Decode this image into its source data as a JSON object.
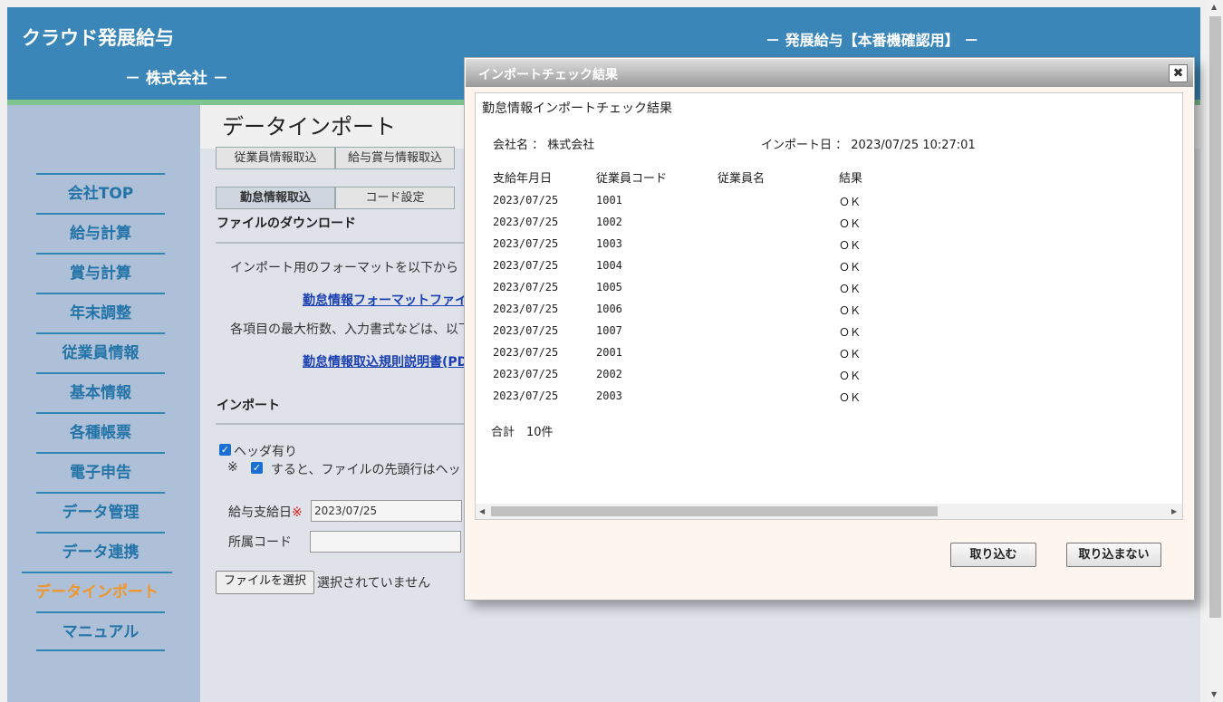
{
  "header": {
    "logo": "クラウド発展給与",
    "company": "－ 株式会社 －",
    "system_name": "－ 発展給与【本番機確認用】 －"
  },
  "sidebar": {
    "items": [
      {
        "label": "会社TOP"
      },
      {
        "label": "給与計算"
      },
      {
        "label": "賞与計算"
      },
      {
        "label": "年末調整"
      },
      {
        "label": "従業員情報"
      },
      {
        "label": "基本情報"
      },
      {
        "label": "各種帳票"
      },
      {
        "label": "電子申告"
      },
      {
        "label": "データ管理"
      },
      {
        "label": "データ連携"
      },
      {
        "label": "データインポート",
        "active": true
      },
      {
        "label": "マニュアル"
      }
    ]
  },
  "main": {
    "title": "データインポート",
    "tabs_row1": [
      "従業員情報取込",
      "給与賞与情報取込"
    ],
    "tabs_row2": [
      "勤怠情報取込",
      "コード設定"
    ],
    "download_section": "ファイルのダウンロード",
    "download_text": "インポート用のフォーマットを以下から",
    "format_link": "勤怠情報フォーマットファイ",
    "rules_text": "各項目の最大桁数、入力書式などは、以下",
    "rules_link": "勤怠情報取込規則説明書(PD",
    "import_section": "インポート",
    "header_checkbox_label": "ヘッダ有り",
    "note_prefix": "※",
    "note_text": "すると、ファイルの先頭行はヘッ",
    "payday_label": "給与支給日",
    "required_mark": "※",
    "payday_value": "2023/07/25",
    "dept_label": "所属コード",
    "dept_value": "",
    "file_button": "ファイルを選択",
    "file_status": "選択されていません"
  },
  "dialog": {
    "title": "インポートチェック結果",
    "close_symbol": "✖",
    "heading": "勤怠情報インポートチェック結果",
    "company_label": "会社名 ： 株式会社",
    "import_date_label": "インポート日 ： 2023/07/25 10:27:01",
    "columns": [
      "支給年月日",
      "従業員コード",
      "従業員名",
      "結果"
    ],
    "rows": [
      {
        "date": "2023/07/25",
        "code": "1001",
        "name": "",
        "result": "ＯＫ"
      },
      {
        "date": "2023/07/25",
        "code": "1002",
        "name": "",
        "result": "ＯＫ"
      },
      {
        "date": "2023/07/25",
        "code": "1003",
        "name": "",
        "result": "ＯＫ"
      },
      {
        "date": "2023/07/25",
        "code": "1004",
        "name": "",
        "result": "ＯＫ"
      },
      {
        "date": "2023/07/25",
        "code": "1005",
        "name": "",
        "result": "ＯＫ"
      },
      {
        "date": "2023/07/25",
        "code": "1006",
        "name": "",
        "result": "ＯＫ"
      },
      {
        "date": "2023/07/25",
        "code": "1007",
        "name": "",
        "result": "ＯＫ"
      },
      {
        "date": "2023/07/25",
        "code": "2001",
        "name": "",
        "result": "ＯＫ"
      },
      {
        "date": "2023/07/25",
        "code": "2002",
        "name": "",
        "result": "ＯＫ"
      },
      {
        "date": "2023/07/25",
        "code": "2003",
        "name": "",
        "result": "ＯＫ"
      }
    ],
    "total": "合計　10件",
    "import_button": "取り込む",
    "cancel_button": "取り込まない"
  }
}
